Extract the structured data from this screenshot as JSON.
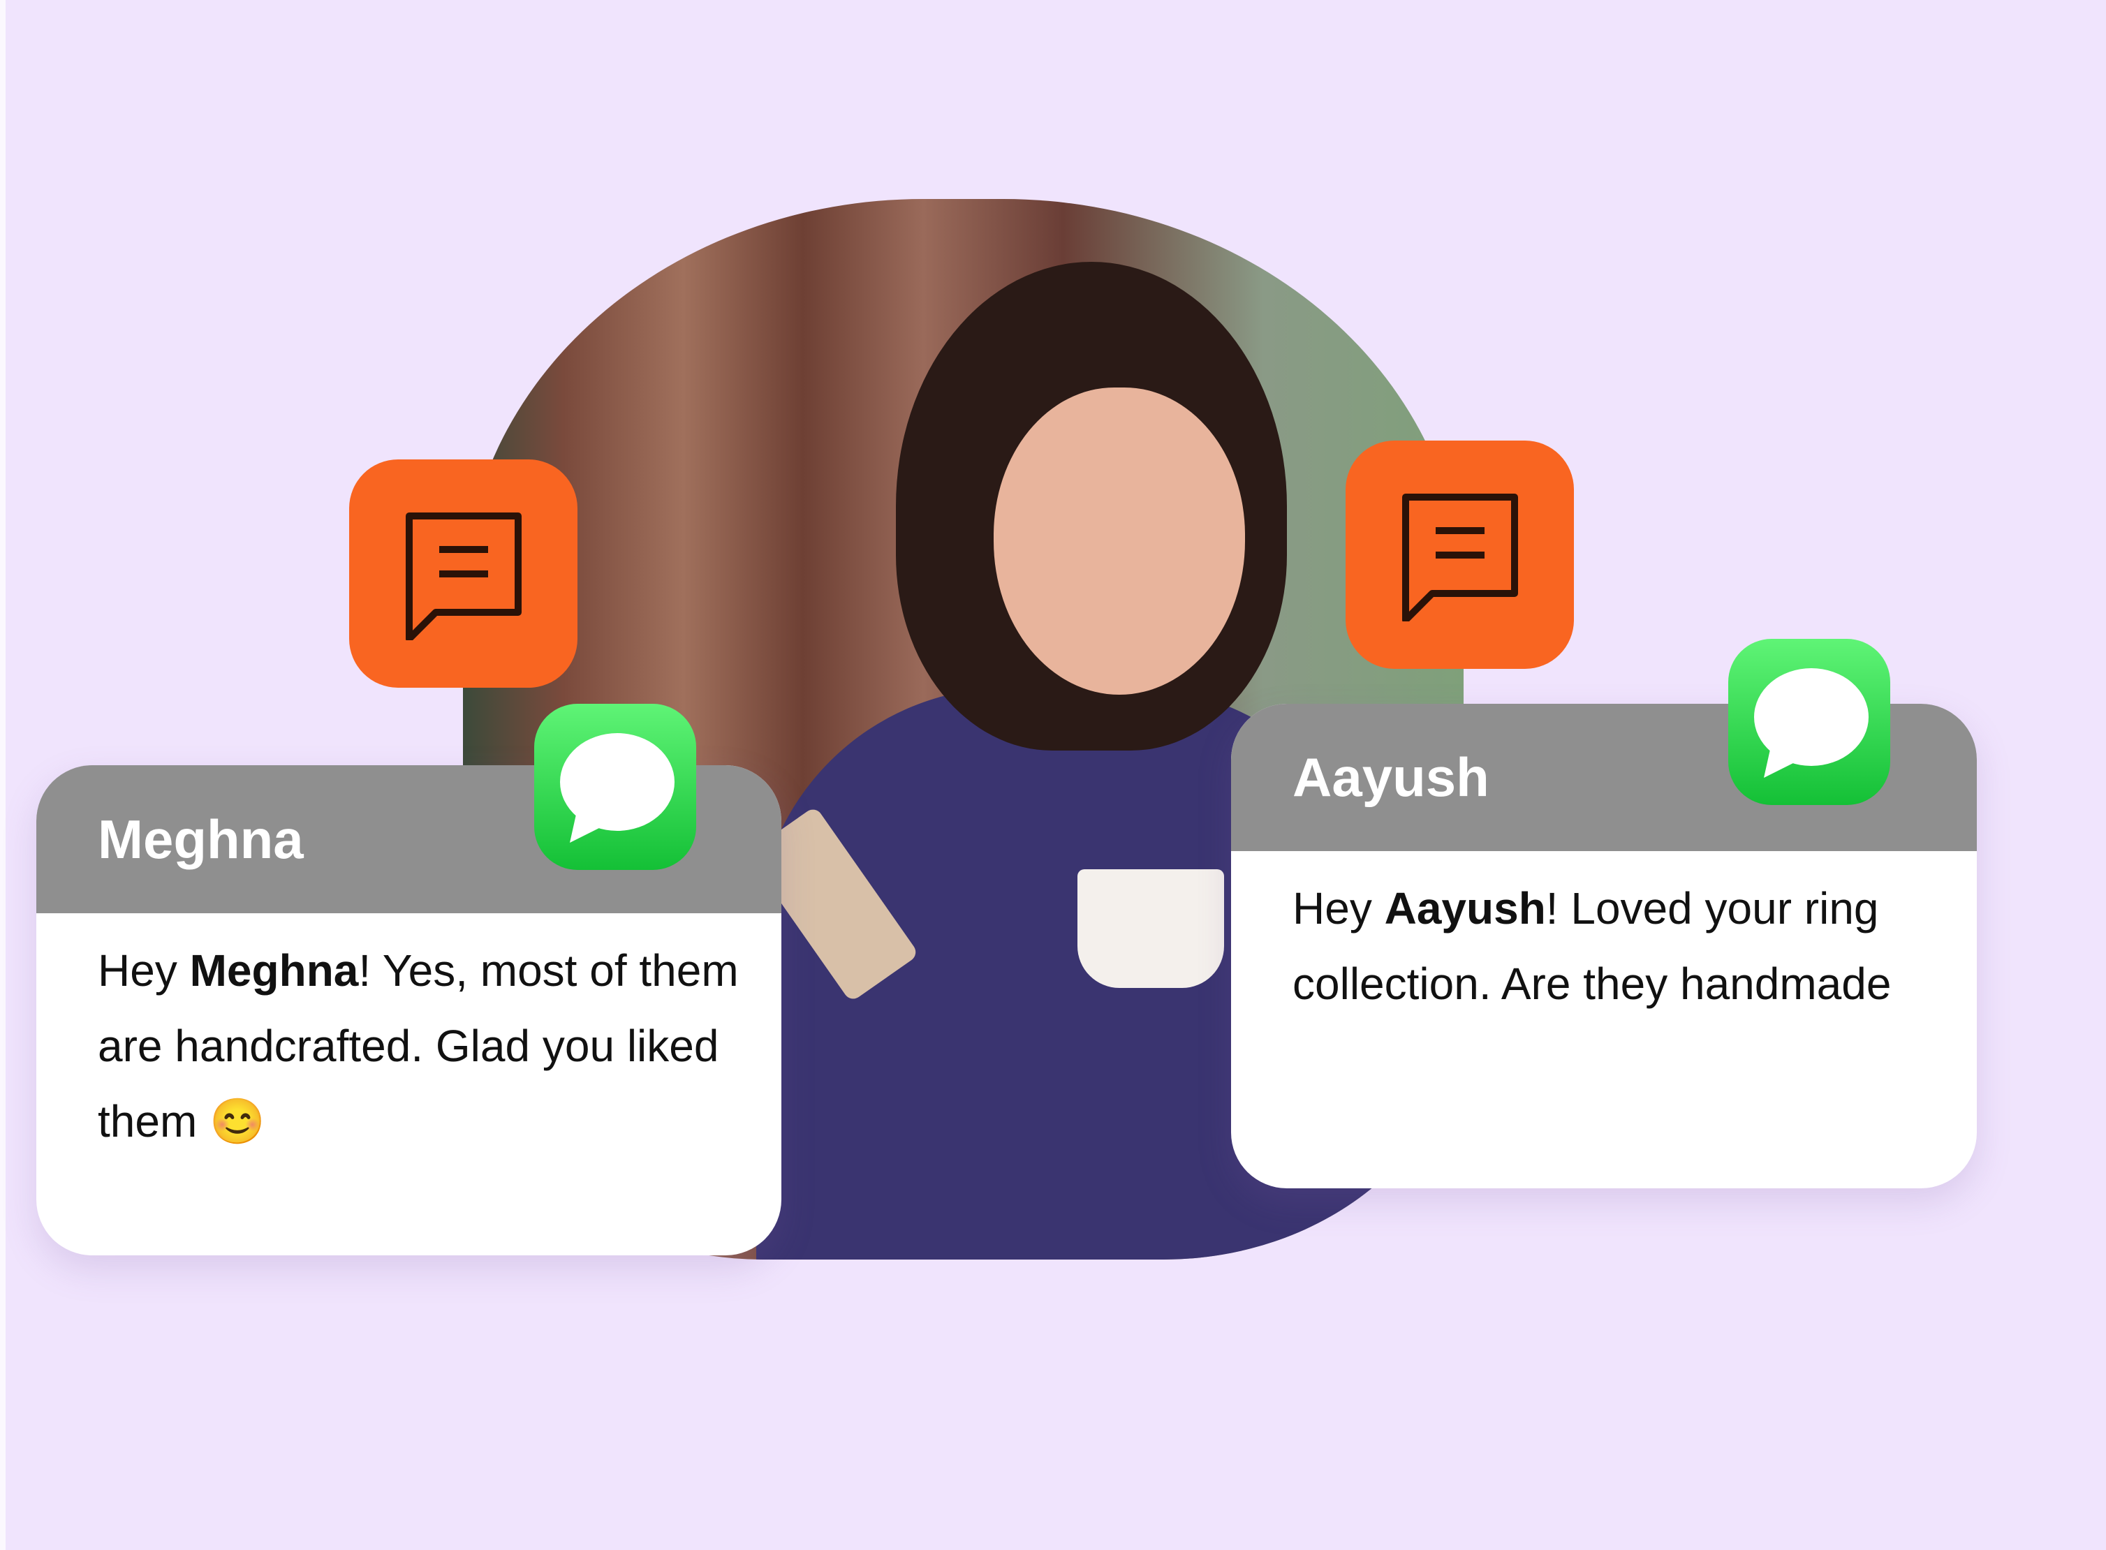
{
  "background_color": "#f0e4fd",
  "accent_orange": "#f96521",
  "messages": [
    {
      "name": "Meghna",
      "text_before": "Hey ",
      "text_bold": "Meghna",
      "text_after": "! Yes, most of them are handcrafted. Glad you liked them",
      "emoji": "😊",
      "icon": "imessage-icon"
    },
    {
      "name": "Aayush",
      "text_before": "Hey ",
      "text_bold": "Aayush",
      "text_after": "! Loved your ring collection. Are they handmade",
      "icon": "imessage-icon"
    }
  ],
  "icons": {
    "chat": "chat-bubble-icon",
    "imessage": "imessage-icon"
  }
}
